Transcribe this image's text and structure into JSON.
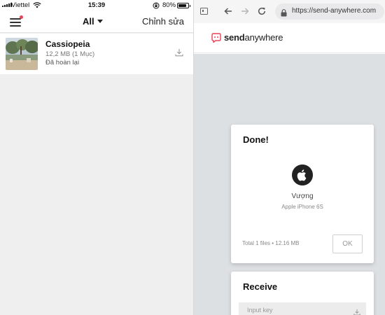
{
  "status_bar": {
    "carrier": "Viettel",
    "time": "15:39",
    "battery": "80%",
    "battery_level": 0.8
  },
  "app_header": {
    "filter_label": "All",
    "edit_label": "Chỉnh sửa"
  },
  "files": [
    {
      "name": "Cassiopeia",
      "meta": "12,2 MB (1 Mục)",
      "status": "Đã hoàn lại"
    }
  ],
  "browser": {
    "url": "https://send-anywhere.com"
  },
  "site": {
    "brand_bold": "send",
    "brand_rest": "anywhere"
  },
  "done_card": {
    "title": "Done!",
    "device_name": "Vượng",
    "device_model": "Apple iPhone 6S",
    "summary": "Total 1 files • 12.16 MB",
    "ok_label": "OK"
  },
  "receive_card": {
    "title": "Receive",
    "input_placeholder": "Input key"
  },
  "colors": {
    "brand_accent": "#e84357",
    "page_bg": "#dde0e3",
    "list_bg": "#efeff0"
  },
  "icons": {
    "menu": "hamburger-icon",
    "caret": "caret-down-icon",
    "download": "download-icon",
    "back": "arrow-left-icon",
    "forward": "arrow-right-icon",
    "reload": "reload-icon",
    "lock": "lock-icon",
    "tabs": "tabs-icon",
    "device": "apple-icon",
    "logo": "send-anywhere-logo-icon"
  }
}
